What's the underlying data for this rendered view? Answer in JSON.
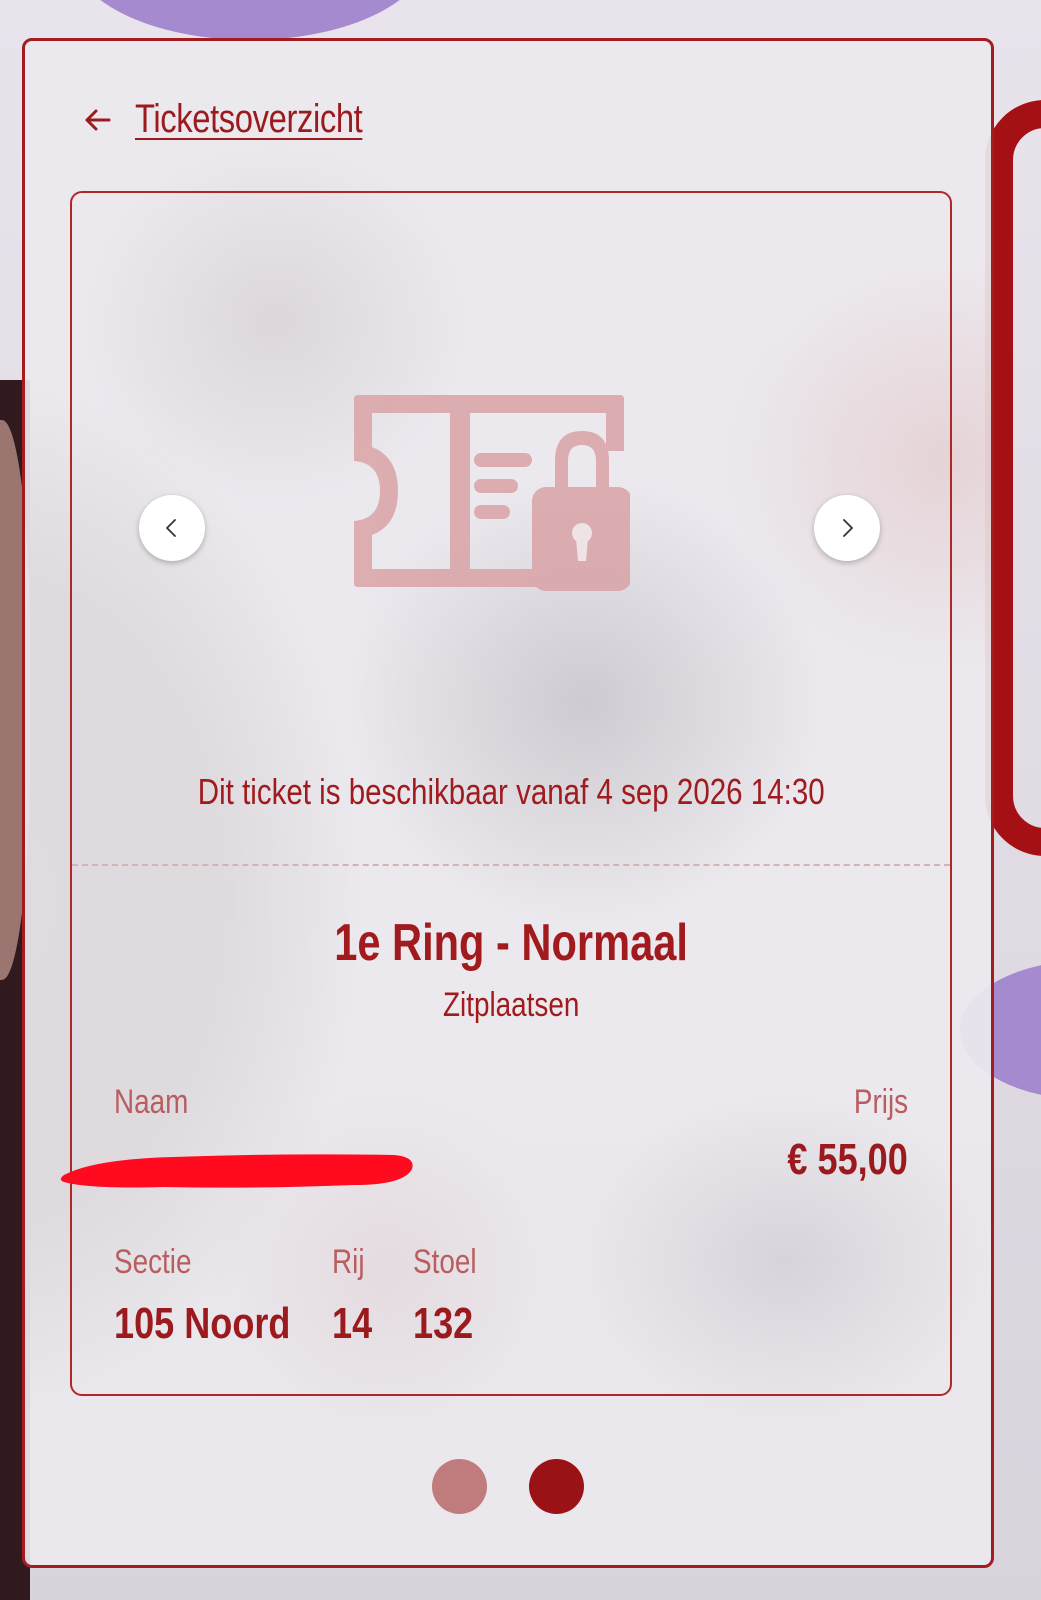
{
  "header": {
    "back_label": "Ticketsoverzicht",
    "back_icon": "arrow-left-icon"
  },
  "ticket": {
    "locked_icon": "locked-ticket-icon",
    "availability_text": "Dit ticket is beschikbaar vanaf 4 sep 2026 14:30",
    "type_title": "1e Ring - Normaal",
    "type_subtitle": "Zitplaatsen",
    "name": {
      "label": "Naam",
      "value_redacted": true
    },
    "price": {
      "label": "Prijs",
      "value": "€ 55,00"
    },
    "section": {
      "label": "Sectie",
      "value": "105 Noord"
    },
    "row": {
      "label": "Rij",
      "value": "14"
    },
    "seat": {
      "label": "Stoel",
      "value": "132"
    }
  },
  "carousel": {
    "prev_icon": "chevron-left-icon",
    "next_icon": "chevron-right-icon",
    "page_count": 2,
    "active_page": 2
  },
  "colors": {
    "accent": "#9b1a1d",
    "label": "#b95e60",
    "dot_inactive": "#c07c7c",
    "dot_active": "#9a1216",
    "redaction": "#ff0a1e"
  }
}
